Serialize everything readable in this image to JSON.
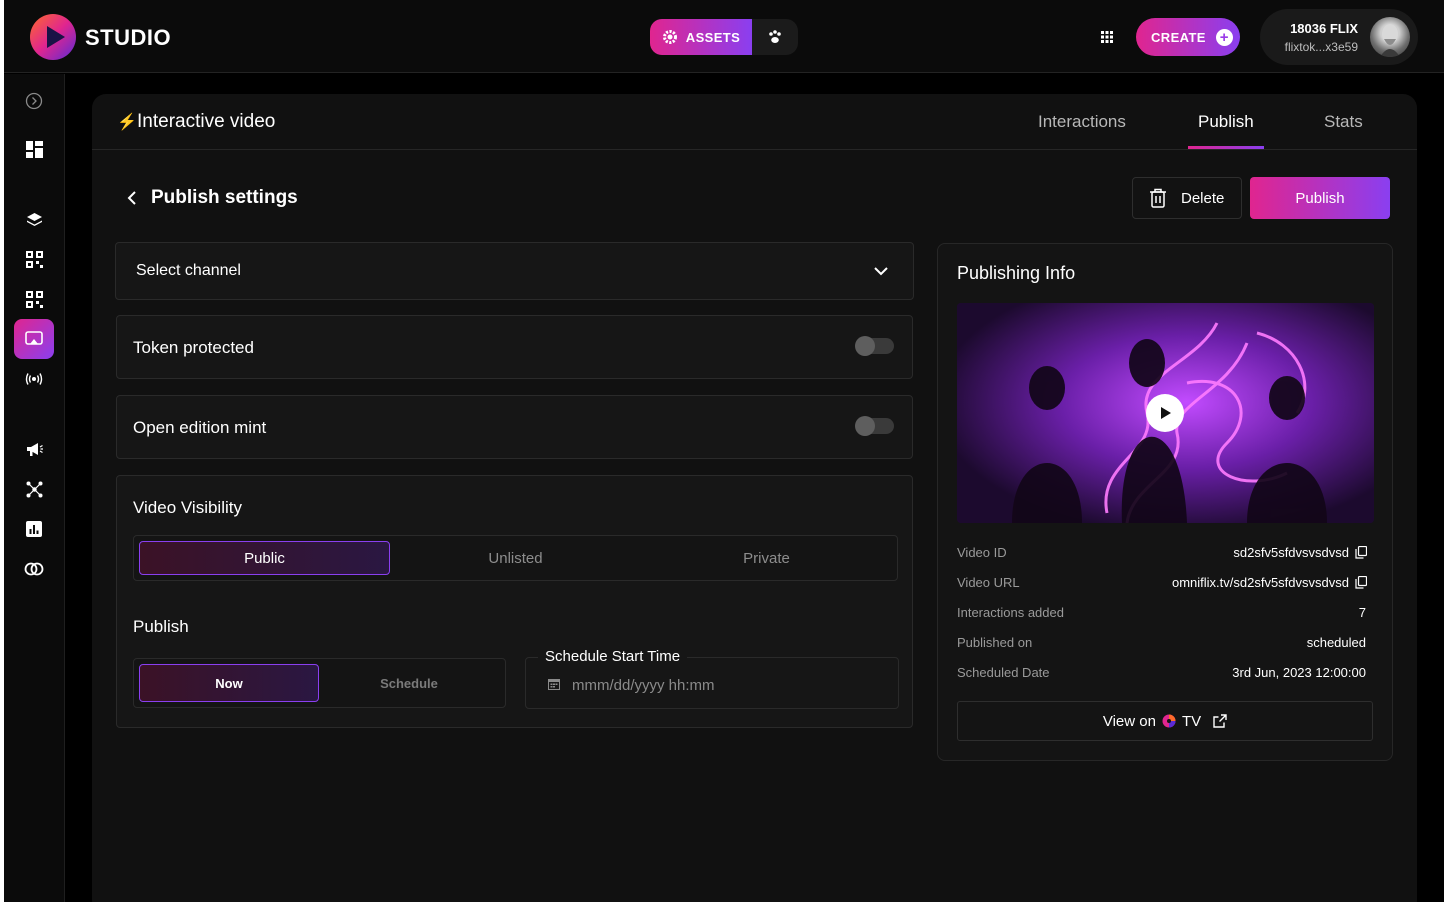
{
  "header": {
    "brand": "STUDIO",
    "assets_label": "ASSETS",
    "create_label": "CREATE",
    "user_balance": "18036 FLIX",
    "user_address": "flixtok...x3e59"
  },
  "sidebar": {
    "items": [
      "toggle-sidebar-icon",
      "dashboard-icon",
      "layers-icon",
      "qr-icon",
      "qr-icon-2",
      "interactive-video-icon",
      "broadcast-icon",
      "megaphone-icon",
      "network-icon",
      "stats-icon",
      "link-icon"
    ],
    "active": "interactive-video-icon"
  },
  "panel": {
    "title": "Interactive video",
    "tabs": [
      {
        "label": "Interactions",
        "active": false
      },
      {
        "label": "Publish",
        "active": true
      },
      {
        "label": "Stats",
        "active": false
      }
    ]
  },
  "publish_settings": {
    "title": "Publish settings",
    "delete_label": "Delete",
    "publish_label": "Publish",
    "select_channel": "Select channel",
    "token_protected": {
      "label": "Token protected",
      "enabled": false
    },
    "open_edition_mint": {
      "label": "Open edition mint",
      "enabled": false
    },
    "visibility": {
      "title": "Video Visibility",
      "options": [
        "Public",
        "Unlisted",
        "Private"
      ],
      "selected": "Public"
    },
    "publish_mode": {
      "title": "Publish",
      "options": [
        "Now",
        "Schedule"
      ],
      "selected": "Now"
    },
    "schedule": {
      "label": "Schedule Start Time",
      "placeholder": "mmm/dd/yyyy hh:mm",
      "value": ""
    }
  },
  "publishing_info": {
    "title": "Publishing Info",
    "rows": [
      {
        "key": "Video ID",
        "value": "sd2sfv5sfdvsvsdvsd",
        "copyable": true
      },
      {
        "key": "Video URL",
        "value": "omniflix.tv/sd2sfv5sfdvsvsdvsd",
        "copyable": true
      },
      {
        "key": "Interactions added",
        "value": "7",
        "copyable": false
      },
      {
        "key": "Published on",
        "value": "scheduled",
        "copyable": false
      },
      {
        "key": "Scheduled Date",
        "value": "3rd Jun, 2023 12:00:00",
        "copyable": false
      }
    ],
    "view_on_prefix": "View on",
    "view_on_suffix": "TV"
  },
  "colors": {
    "accent_start": "#e0258f",
    "accent_end": "#8a3ff0",
    "background": "#000000",
    "panel": "#111111"
  }
}
